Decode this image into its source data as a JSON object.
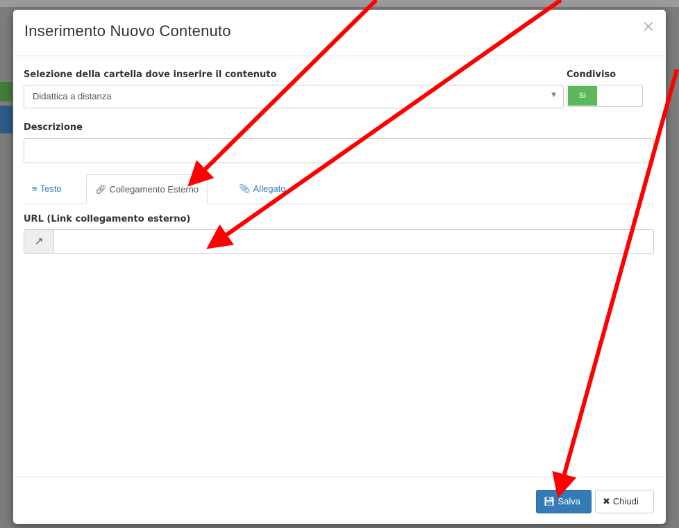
{
  "modal": {
    "title": "Inserimento Nuovo Contenuto",
    "close_glyph": "×"
  },
  "folder": {
    "label": "Selezione della cartella dove inserire il contenuto",
    "value": "Didattica a distanza"
  },
  "shared": {
    "label": "Condiviso",
    "toggle_on_text": "SI"
  },
  "description": {
    "label": "Descrizione",
    "value": ""
  },
  "tabs": [
    {
      "label": "Testo",
      "icon": "list-icon"
    },
    {
      "label": "Collegamento Esterno",
      "icon": "link-icon",
      "active": true
    },
    {
      "label": "Allegato",
      "icon": "paperclip-icon"
    }
  ],
  "url": {
    "label": "URL (Link collegamento esterno)",
    "value": ""
  },
  "footer": {
    "save_label": "Salva",
    "close_label": "Chiudi"
  },
  "colors": {
    "primary": "#337ab7",
    "success": "#5cb85c",
    "annotation_arrow": "#ff0000"
  }
}
